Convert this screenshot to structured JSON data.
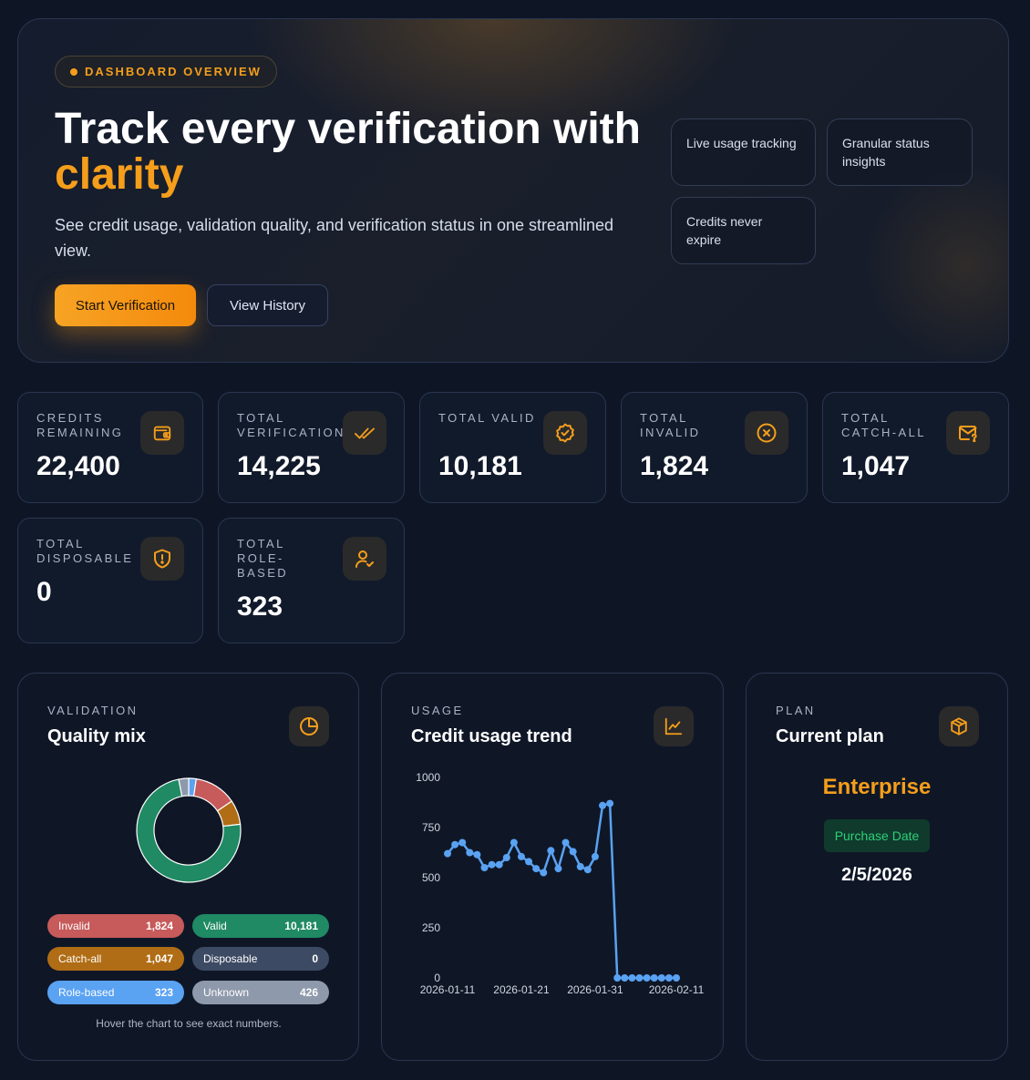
{
  "hero": {
    "pill": "DASHBOARD OVERVIEW",
    "title_line1": "Track every verification with",
    "title_line2": "clarity",
    "lead": "See credit usage, validation quality, and verification status in one streamlined view.",
    "primary_button": "Start Verification",
    "secondary_button": "View History",
    "features": [
      "Live usage tracking",
      "Granular status insights",
      "Credits never expire"
    ]
  },
  "stats": [
    {
      "label": "CREDITS REMAINING",
      "value": "22,400",
      "icon": "wallet-icon"
    },
    {
      "label": "TOTAL VERIFICATIONS",
      "value": "14,225",
      "icon": "double-check-icon"
    },
    {
      "label": "TOTAL VALID",
      "value": "10,181",
      "icon": "badge-check-icon"
    },
    {
      "label": "TOTAL INVALID",
      "value": "1,824",
      "icon": "x-circle-icon"
    },
    {
      "label": "TOTAL CATCH-ALL",
      "value": "1,047",
      "icon": "mail-question-icon"
    },
    {
      "label": "TOTAL DISPOSABLE",
      "value": "0",
      "icon": "shield-alert-icon"
    },
    {
      "label": "TOTAL ROLE-BASED",
      "value": "323",
      "icon": "user-check-icon"
    }
  ],
  "quality": {
    "eyebrow": "VALIDATION",
    "title": "Quality mix",
    "hint": "Hover the chart to see exact numbers.",
    "legend": [
      {
        "label": "Invalid",
        "value": "1,824",
        "color": "#c75a5a"
      },
      {
        "label": "Valid",
        "value": "10,181",
        "color": "#1f8a63"
      },
      {
        "label": "Catch-all",
        "value": "1,047",
        "color": "#b06d15"
      },
      {
        "label": "Disposable",
        "value": "0",
        "color": "#3d4a63"
      },
      {
        "label": "Role-based",
        "value": "323",
        "color": "#5aa2f2"
      },
      {
        "label": "Unknown",
        "value": "426",
        "color": "#8e99ab"
      }
    ]
  },
  "usage": {
    "eyebrow": "USAGE",
    "title": "Credit usage trend"
  },
  "plan": {
    "eyebrow": "PLAN",
    "title": "Current plan",
    "name": "Enterprise",
    "badge": "Purchase Date",
    "date": "2/5/2026"
  },
  "chart_data": [
    {
      "type": "pie",
      "categories": [
        "Role-based",
        "Invalid",
        "Catch-all",
        "Valid",
        "Unknown",
        "Disposable"
      ],
      "values": [
        323,
        1824,
        1047,
        10181,
        426,
        0
      ],
      "colors": [
        "#5aa2f2",
        "#c75a5a",
        "#b06d15",
        "#1f8a63",
        "#8e99ab",
        "#3d4a63"
      ]
    },
    {
      "type": "line",
      "x": [
        "2026-01-11",
        "2026-01-12",
        "2026-01-13",
        "2026-01-14",
        "2026-01-15",
        "2026-01-16",
        "2026-01-17",
        "2026-01-18",
        "2026-01-19",
        "2026-01-20",
        "2026-01-21",
        "2026-01-22",
        "2026-01-23",
        "2026-01-24",
        "2026-01-25",
        "2026-01-26",
        "2026-01-27",
        "2026-01-28",
        "2026-01-29",
        "2026-01-30",
        "2026-01-31",
        "2026-02-01",
        "2026-02-02",
        "2026-02-03",
        "2026-02-04",
        "2026-02-05",
        "2026-02-06",
        "2026-02-07",
        "2026-02-08",
        "2026-02-09",
        "2026-02-10",
        "2026-02-11"
      ],
      "values": [
        620,
        665,
        675,
        625,
        615,
        550,
        565,
        565,
        600,
        675,
        605,
        580,
        545,
        525,
        635,
        545,
        675,
        630,
        555,
        540,
        605,
        860,
        870,
        0,
        0,
        0,
        0,
        0,
        0,
        0,
        0,
        0
      ],
      "xticks": [
        "2026-01-11",
        "2026-01-21",
        "2026-01-31",
        "2026-02-11"
      ],
      "yticks": [
        0,
        250,
        500,
        750,
        1000
      ],
      "ylim": [
        0,
        1000
      ],
      "color": "#5aa2f2"
    }
  ]
}
